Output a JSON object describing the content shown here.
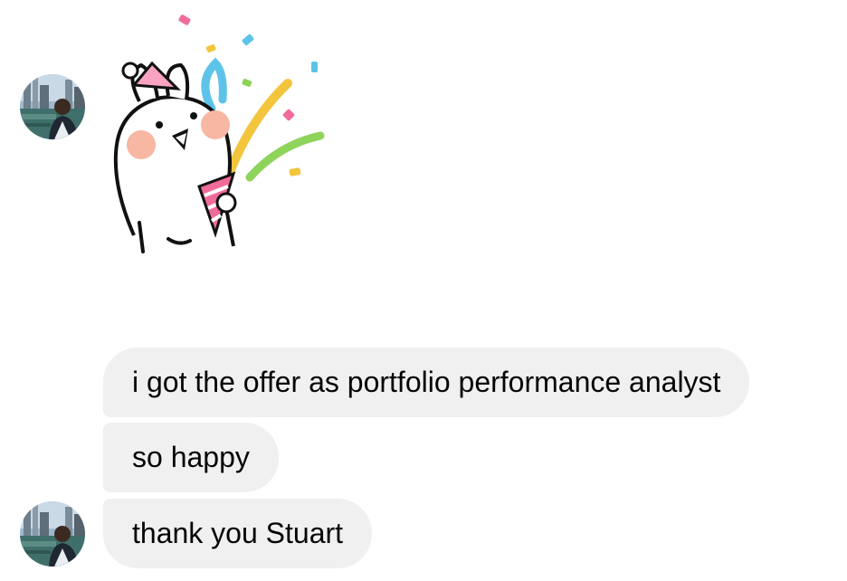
{
  "conversation": {
    "sticker": {
      "icon": "party-rabbit-sticker-icon"
    },
    "avatar": {
      "icon": "user-avatar-icon"
    },
    "messages": [
      {
        "text": "i got the offer as portfolio performance analyst"
      },
      {
        "text": "so happy"
      },
      {
        "text": "thank you Stuart"
      }
    ],
    "colors": {
      "bubble_background": "#f0f0f0",
      "text": "#050505",
      "background": "#ffffff"
    }
  }
}
